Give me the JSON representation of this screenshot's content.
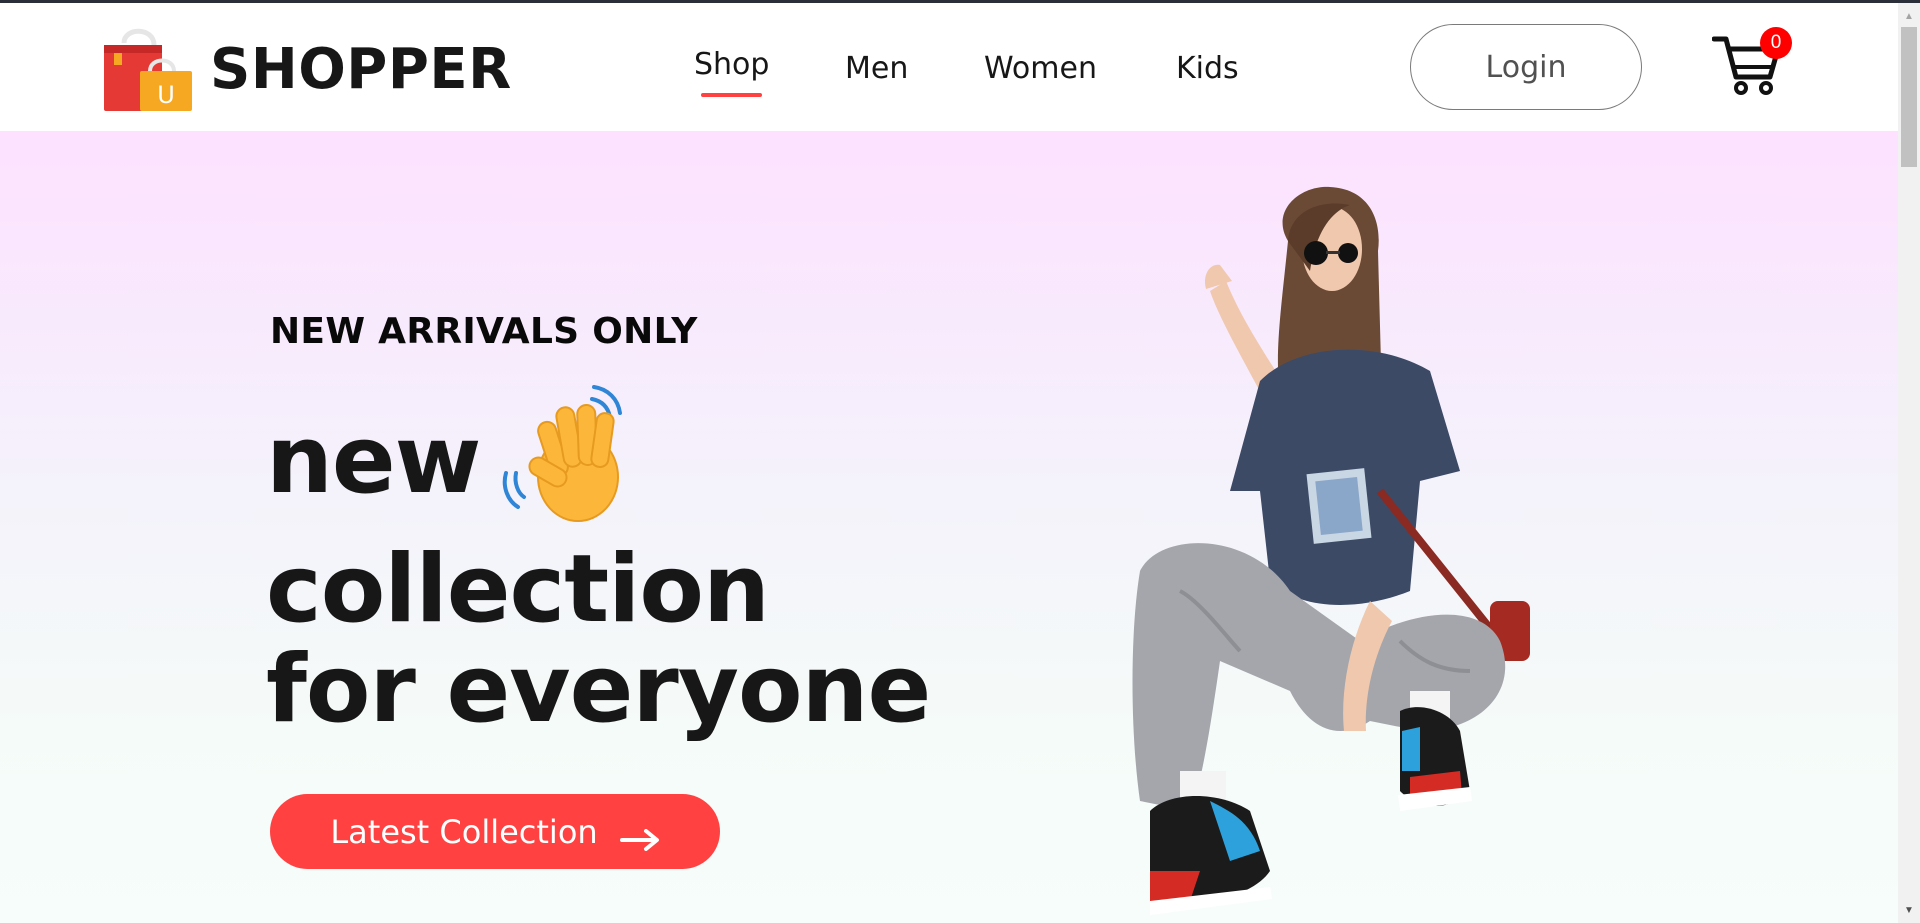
{
  "brand": {
    "name": "SHOPPER",
    "logo_icon": "shopping-bag-icon"
  },
  "nav": {
    "items": [
      {
        "label": "Shop",
        "active": true
      },
      {
        "label": "Men",
        "active": false
      },
      {
        "label": "Women",
        "active": false
      },
      {
        "label": "Kids",
        "active": false
      }
    ]
  },
  "header": {
    "login_label": "Login",
    "cart_count": "0",
    "cart_icon": "cart-icon"
  },
  "hero": {
    "eyebrow": "NEW ARRIVALS ONLY",
    "line1": "new",
    "line2": "collection",
    "line3": "for everyone",
    "emoji_icon": "waving-hand-icon",
    "cta_label": "Latest Collection",
    "cta_icon": "arrow-right-icon",
    "model_image": "hero-model-image"
  },
  "colors": {
    "accent": "#ff4141",
    "badge": "#ff0000",
    "hero_gradient_top": "#fde1ff",
    "hero_gradient_bottom": "#f7fdfb",
    "text": "#171717"
  }
}
